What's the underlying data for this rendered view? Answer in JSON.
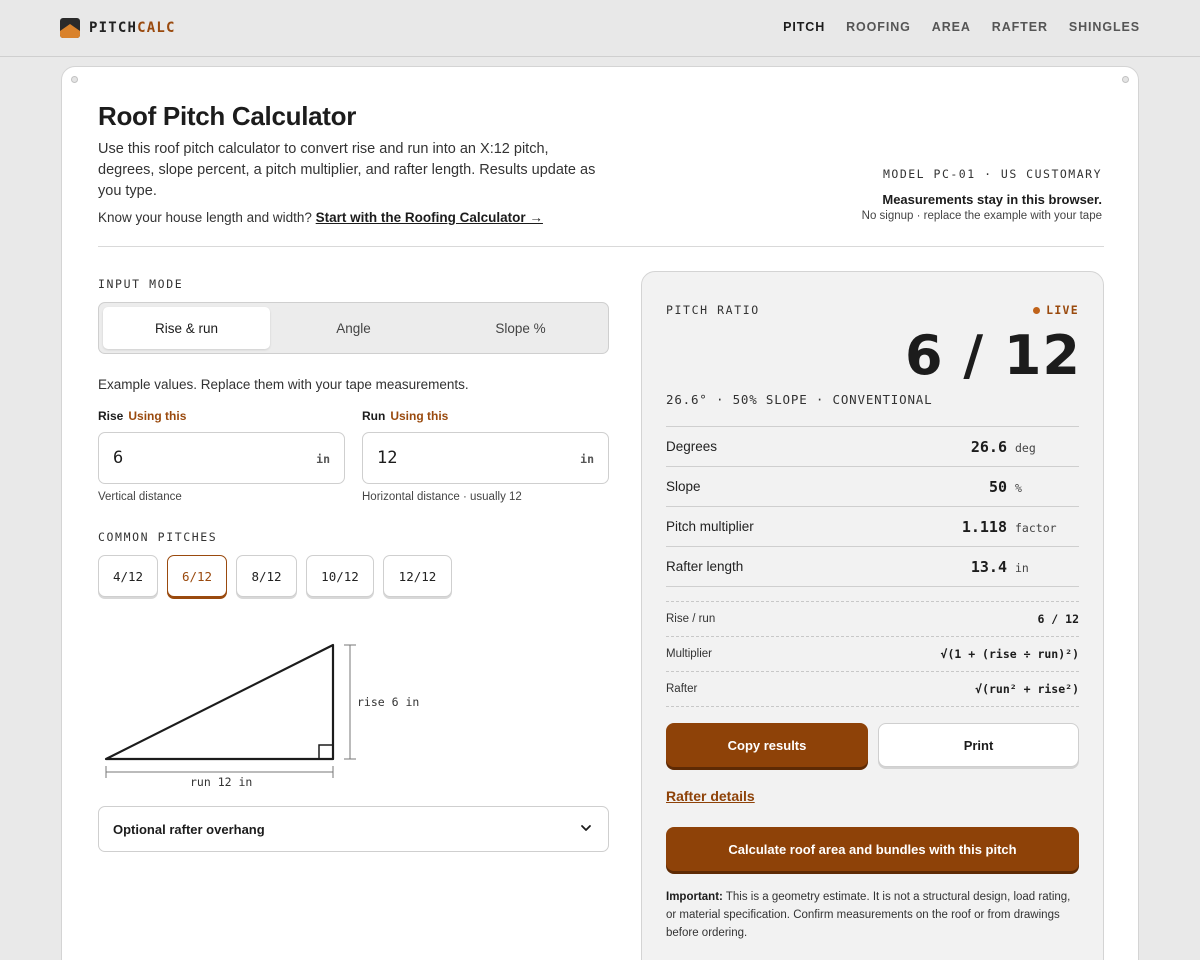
{
  "brand": {
    "part1": "PITCH",
    "part2": "CALC"
  },
  "nav": [
    "PITCH",
    "ROOFING",
    "AREA",
    "RAFTER",
    "SHINGLES"
  ],
  "header": {
    "title": "Roof Pitch Calculator",
    "intro": "Use this roof pitch calculator to convert rise and run into an X:12 pitch, degrees, slope percent, a pitch multiplier, and rafter length. Results update as you type.",
    "hint_text": "Know your house length and width?",
    "hint_link": "Start with the Roofing Calculator →",
    "model": "MODEL PC-01 · US CUSTOMARY",
    "privacy": "Measurements stay in this browser.",
    "privacy_sub": "No signup · replace the example with your tape"
  },
  "input": {
    "mode_label": "INPUT MODE",
    "modes": [
      "Rise & run",
      "Angle",
      "Slope %"
    ],
    "selected_mode": "Rise & run",
    "example_note": "Example values. Replace them with your tape measurements.",
    "rise": {
      "label": "Rise",
      "tag": "Using this",
      "value": "6",
      "unit": "in",
      "help": "Vertical distance"
    },
    "run": {
      "label": "Run",
      "tag": "Using this",
      "value": "12",
      "unit": "in",
      "help": "Horizontal distance · usually 12"
    }
  },
  "common": {
    "label": "COMMON PITCHES",
    "pitches": [
      "4/12",
      "6/12",
      "8/12",
      "10/12",
      "12/12"
    ],
    "active": "6/12"
  },
  "diagram": {
    "rise_label": "rise 6 in",
    "run_label": "run 12 in"
  },
  "overhang": {
    "label": "Optional rafter overhang",
    "icon": "chevron-down-icon"
  },
  "results": {
    "panel_label": "PITCH RATIO",
    "live": "LIVE",
    "ratio": "6 / 12",
    "summary": "26.6° · 50% SLOPE · CONVENTIONAL",
    "rows": [
      {
        "label": "Degrees",
        "value": "26.6",
        "unit": "deg"
      },
      {
        "label": "Slope",
        "value": "50",
        "unit": "%"
      },
      {
        "label": "Pitch multiplier",
        "value": "1.118",
        "unit": "factor"
      },
      {
        "label": "Rafter length",
        "value": "13.4",
        "unit": "in"
      }
    ],
    "formulas": [
      {
        "label": "Rise / run",
        "value": "6 / 12"
      },
      {
        "label": "Multiplier",
        "value": "√(1 + (rise ÷ run)²)"
      },
      {
        "label": "Rafter",
        "value": "√(run² + rise²)"
      }
    ],
    "copy_button": "Copy results",
    "print_button": "Print",
    "rafter_link": "Rafter details",
    "cta_button": "Calculate roof area and bundles with this pitch",
    "note_strong": "Important:",
    "note_text": " This is a geometry estimate. It is not a structural design, load rating, or material specification. Confirm measurements on the roof or from drawings before ordering."
  },
  "colors": {
    "accent": "#8e4208",
    "live_dot": "#c0631a",
    "background": "#e9e9e9",
    "panel": "#f2f2f2"
  }
}
